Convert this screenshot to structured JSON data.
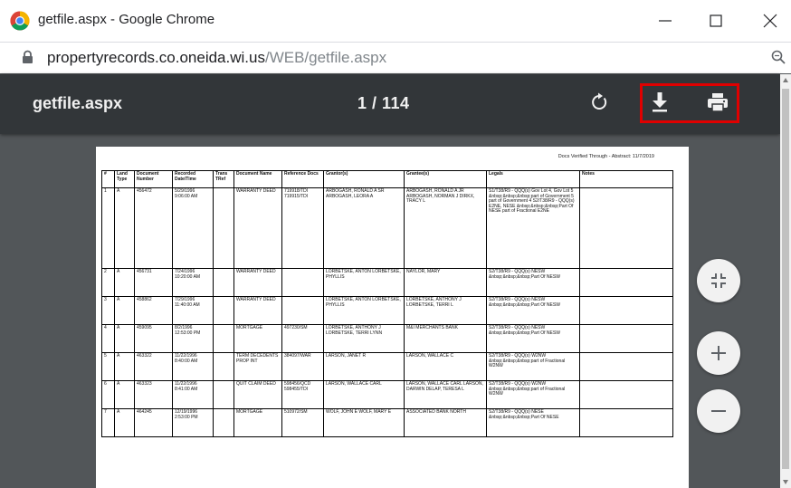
{
  "window": {
    "title": "getfile.aspx - Google Chrome"
  },
  "address": {
    "domain": "propertyrecords.co.oneida.wi.us",
    "path": "/WEB/getfile.aspx"
  },
  "pdf_toolbar": {
    "file_name": "getfile.aspx",
    "page_indicator": "1 / 114",
    "icons": [
      "rotate-icon",
      "download-icon",
      "print-icon"
    ],
    "highlight_color": "#e00000"
  },
  "document": {
    "header": "Docs Verified Through - Abstract: 11/7/2019",
    "columns": [
      "#",
      "Land Type",
      "Document Number",
      "Recorded Date/Time",
      "Trans TRef",
      "Document Name",
      "Reference Docs",
      "Grantor(s)",
      "Grantee(s)",
      "Legals",
      "Notes"
    ],
    "rows": [
      [
        "1",
        "A",
        "456472",
        "5/29/1996 9:06:00 AM",
        "",
        "WARRANTY DEED",
        "719918/TDI 719915/TDI",
        "ARBOGASH, RONALD A SR ARBOGASH, LEORA A",
        "ARBOGASH, RONALD A JR ARBOGASH, NORMAN J DIRKX, TRACY L",
        "S1/T38/R9 - QQQ(s) Gov Lot 4, Gov Lot 5 &nbsp;&nbsp;&nbsp;part of Government 5 part of Government 4 S2/T38/R9 - QQQ(s) E2NE, NESE &nbsp;&nbsp;&nbsp;Part Of NESE part of Fractional E2NE",
        ""
      ],
      [
        "2",
        "A",
        "456731",
        "7/24/1996 10:20:00 AM",
        "",
        "WARRANTY DEED",
        "",
        "LORBETSKE, ANTON LORBETSKE, PHYLLIS",
        "NAYLOR, MARY",
        "S2/T38/R9 - QQQ(s) NESW &nbsp;&nbsp;&nbsp;Part Of NESW",
        ""
      ],
      [
        "3",
        "A",
        "458862",
        "7/29/1996 11:40:00 AM",
        "",
        "WARRANTY DEED",
        "",
        "LORBETSKE, ANTON LORBETSKE, PHYLLIS",
        "LORBETSKE, ANTHONY J LORBETSKE, TERRI L",
        "S2/T38/R9 - QQQ(s) NESW &nbsp;&nbsp;&nbsp;Part Of NESW",
        ""
      ],
      [
        "4",
        "A",
        "459095",
        "8/2/1996 12:53:00 PM",
        "",
        "MORTGAGE",
        "497230/SM",
        "LORBETSKE, ANTHONY J LORBETSKE, TERRI LYNN",
        "M&I MERCHANTS BANK",
        "S2/T38/R9 - QQQ(s) NESW &nbsp;&nbsp;&nbsp;Part Of NESW",
        ""
      ],
      [
        "5",
        "A",
        "463322",
        "11/22/1996 8:40:00 AM",
        "",
        "TERM DECEDENTS PROP INT",
        "384097/WAR",
        "LARSON, JANET R",
        "LARSON, WALLACE C",
        "S2/T38/R9 - QQQ(s) W2NW &nbsp;&nbsp;&nbsp;part of Fractional W2NW",
        ""
      ],
      [
        "6",
        "A",
        "463323",
        "11/22/1996 8:41:00 AM",
        "",
        "QUIT CLAIM DEED",
        "598456/QCD 598455/TDI",
        "LARSON, WALLACE CARL",
        "LARSON, WALLACE CARL LARSON, DARWIN DELAP, TERESA L",
        "S2/T38/R9 - QQQ(s) W2NW &nbsp;&nbsp;&nbsp;part of Fractional W2NW",
        ""
      ],
      [
        "7",
        "A",
        "464245",
        "12/19/1996 2:53:00 PM",
        "",
        "MORTGAGE",
        "510972/SM",
        "WOLF, JOHN E WOLF, MARY E",
        "ASSOCIATED BANK NORTH",
        "S2/T38/R9 - QQQ(s) NESE &nbsp;&nbsp;&nbsp;Part Of NESE",
        ""
      ]
    ]
  },
  "fab_icons": [
    "fit-page-icon",
    "zoom-in-icon",
    "zoom-out-icon"
  ]
}
